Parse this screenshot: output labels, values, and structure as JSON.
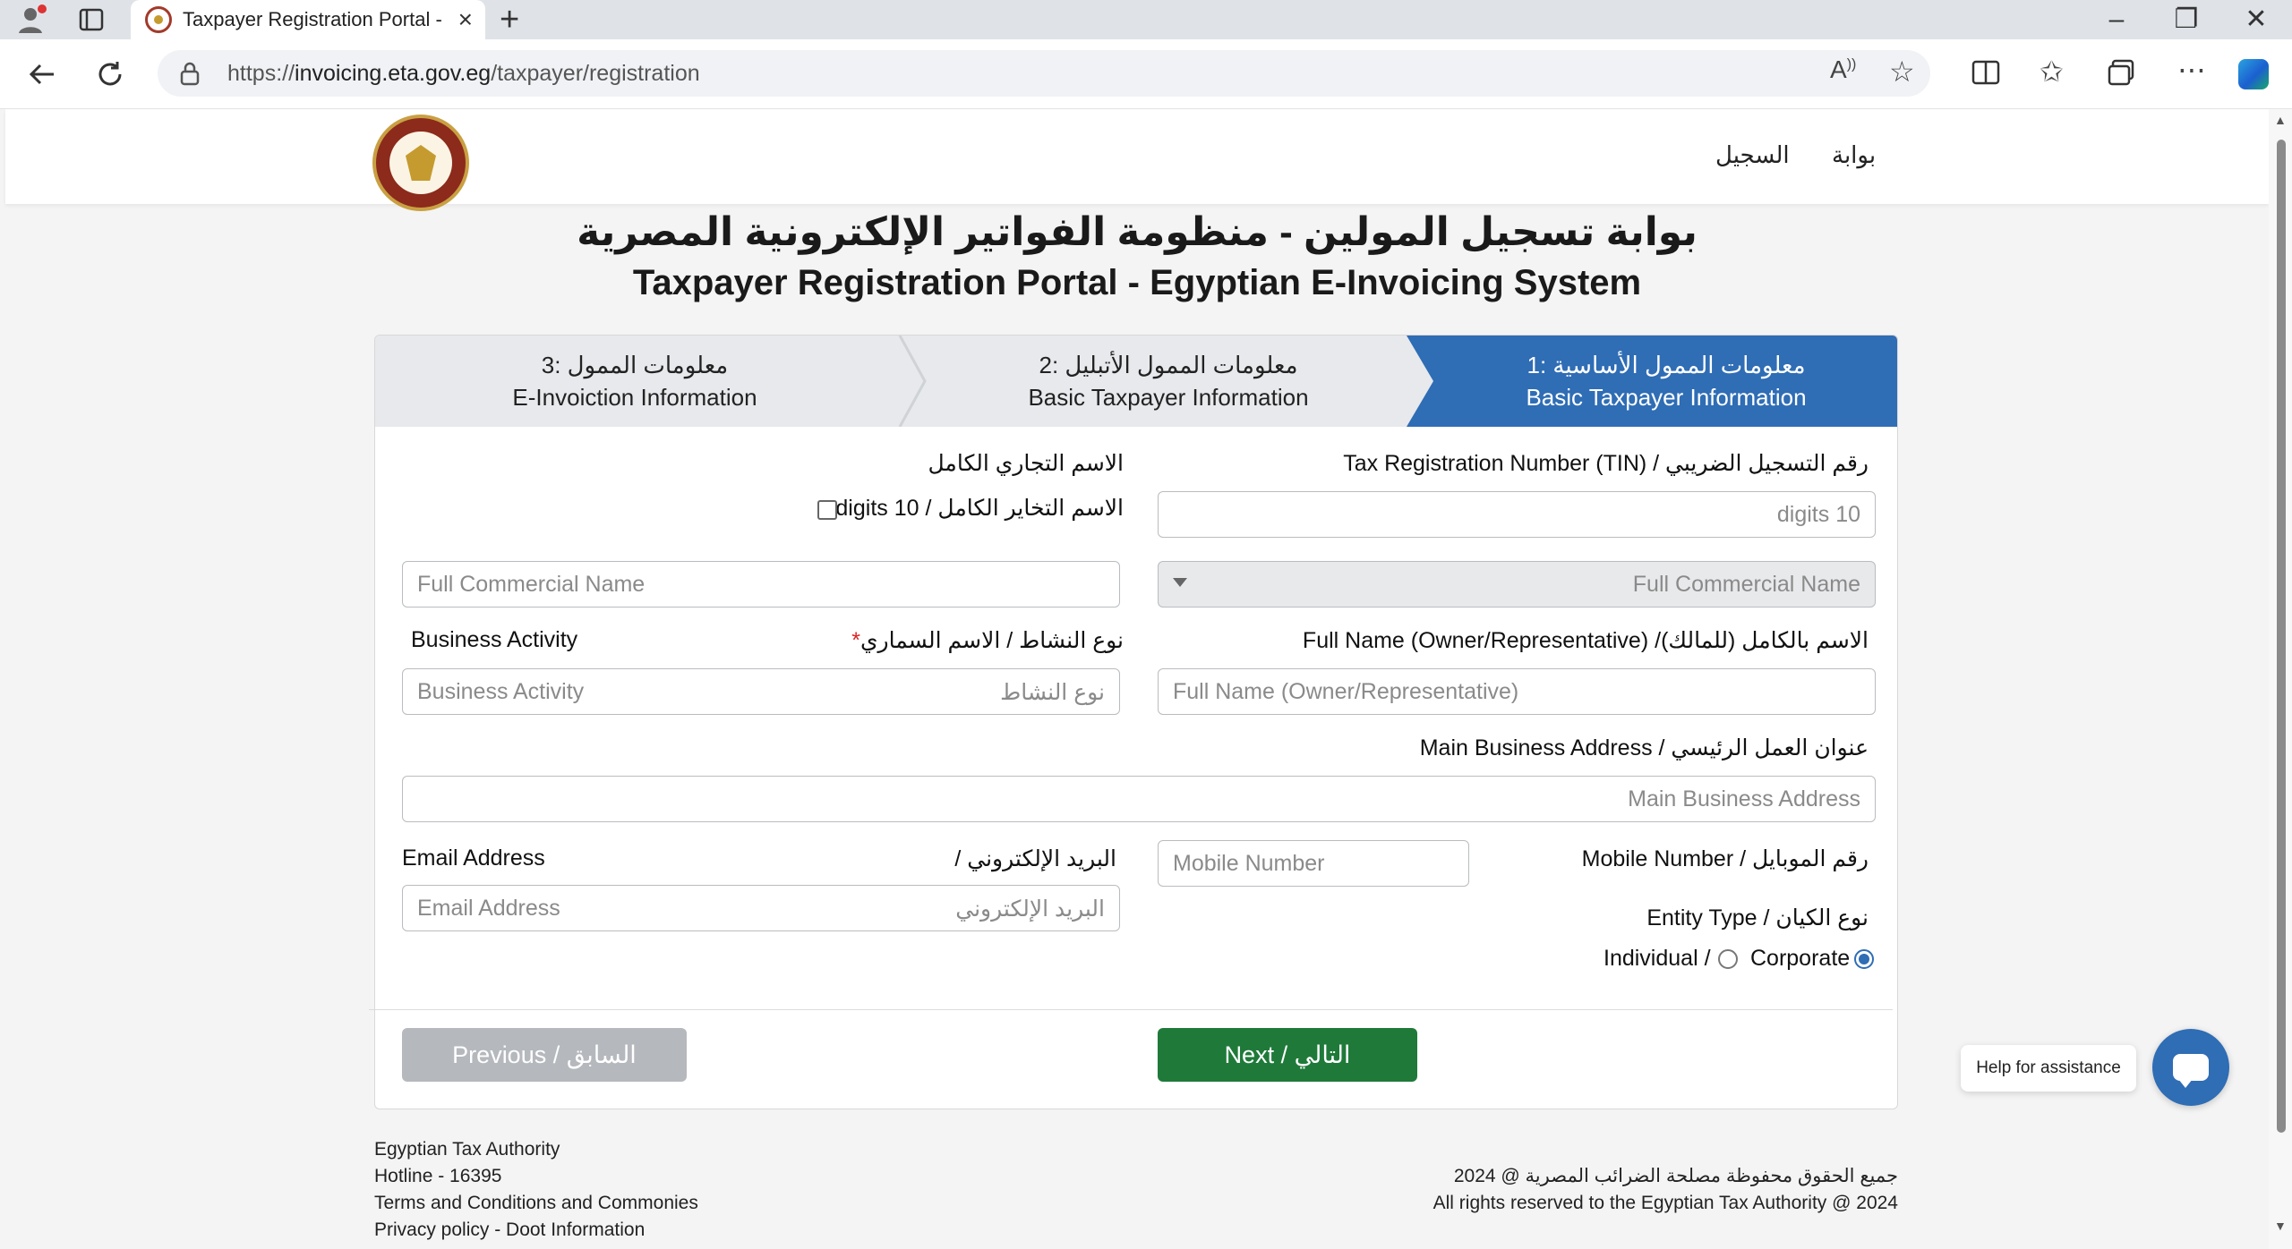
{
  "browser": {
    "tab_title": "Taxpayer Registration Portal - I",
    "url_prefix": "https://",
    "url_host": "invoicing.eta.gov.eg",
    "url_path": "/taxpayer/registration"
  },
  "nav": {
    "item1": "بوابة",
    "item2": "السجيل"
  },
  "header": {
    "title_ar": "بوابة تسجيل المولين - منظومة الفواتير الإلكترونية المصرية",
    "title_en": "Taxpayer Registration Portal - Egyptian E-Invoicing System"
  },
  "steps": [
    {
      "ar": "معلومات الممول الأساسية :1",
      "en": "Basic Taxpayer Information"
    },
    {
      "ar": "معلومات الممول الأتبليل :2",
      "en": "Basic Taxpayer Information"
    },
    {
      "ar": "معلومات الممول :3",
      "en": "E-Invoiction Information"
    }
  ],
  "form": {
    "tin_label": "رقم التسجيل الضريبي / Tax Registration Number (TIN)",
    "tin_placeholder": "10 digits",
    "commercial_label_ar": "الاسم التجاري الكامل",
    "commercial_checkbox_label": "الاسم التخاير الكامل / 10 digits",
    "commercial_select_placeholder": "Full Commercial Name",
    "commercial_input_placeholder": "Full Commercial Name",
    "fullname_label": "الاسم بالكامل (للمالك)/ Full Name (Owner/Representative)",
    "fullname_placeholder": "Full Name (Owner/Representative)",
    "activity_label_ar": "نوع النشاط / الاسم السماري",
    "activity_label_req": "*",
    "activity_label_en": "Business Activity",
    "activity_placeholder_en": "Business Activity",
    "activity_placeholder_ar": "نوع النشاط",
    "address_label": "عنوان العمل الرئيسي / Main Business Address",
    "address_placeholder": "Main Business Address",
    "mobile_label": "رقم الموبايل / Mobile Number",
    "mobile_placeholder": "Mobile Number",
    "email_label_en": "Email Address",
    "email_label_ar": "البريد الإلكتروني /",
    "email_placeholder_en": "Email Address",
    "email_placeholder_ar": "البريد الإلكتروني",
    "entity_label": "نوع الكيان / Entity Type",
    "entity_individual": "Individual /",
    "entity_corporate": "Corporate",
    "prev_button": "Previous / السابق",
    "next_button": "Next / التالي"
  },
  "footer": {
    "left": [
      "Egyptian Tax Authority",
      "Hotline - 16395",
      "Terms and Conditions and Commonies",
      "Privacy policy - Doot Information"
    ],
    "right_ar": "جميع الحقوق محفوظة مصلحة الضرائب المصرية @ 2024",
    "right_en": "All rights reserved to the Egyptian Tax Authority @ 2024"
  },
  "help": {
    "bubble": "Help for assistance"
  },
  "colors": {
    "primary_blue": "#2f6db5",
    "next_green": "#1f7a3a",
    "prev_gray": "#b5b8bd"
  }
}
